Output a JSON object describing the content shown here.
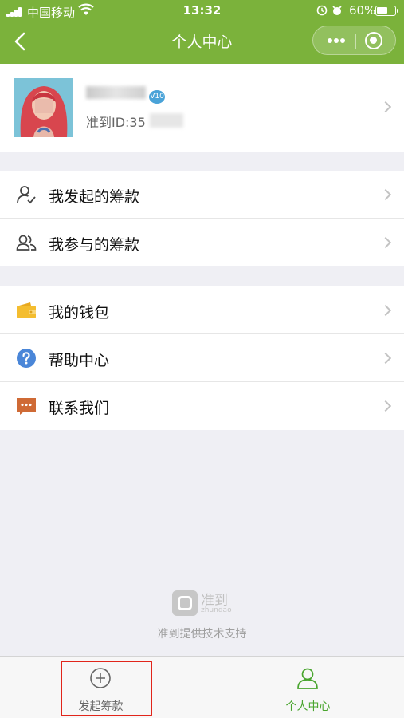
{
  "status_bar": {
    "carrier": "中国移动",
    "time": "13:32",
    "battery": "60%"
  },
  "nav": {
    "title": "个人中心"
  },
  "profile": {
    "vip_badge": "V10",
    "id_label": "准到ID:35"
  },
  "menu_groups": [
    {
      "items": [
        {
          "label": "我发起的筹款",
          "icon": "user-check-icon"
        },
        {
          "label": "我参与的筹款",
          "icon": "users-icon"
        }
      ]
    },
    {
      "items": [
        {
          "label": "我的钱包",
          "icon": "wallet-icon"
        },
        {
          "label": "帮助中心",
          "icon": "question-icon"
        },
        {
          "label": "联系我们",
          "icon": "message-icon"
        }
      ]
    }
  ],
  "footer": {
    "brand": "准到",
    "brand_en": "zhundao",
    "support_text": "准到提供技术支持"
  },
  "tabbar": {
    "tabs": [
      {
        "label": "发起筹款",
        "icon": "plus-circle-icon",
        "active": false
      },
      {
        "label": "个人中心",
        "icon": "person-icon",
        "active": true
      }
    ]
  },
  "colors": {
    "header": "#7bb23b",
    "active_tab": "#49a52e",
    "highlight": "#e1251b",
    "wallet": "#f4bd2f",
    "help": "#4a86d8",
    "contact": "#cf6a35"
  }
}
